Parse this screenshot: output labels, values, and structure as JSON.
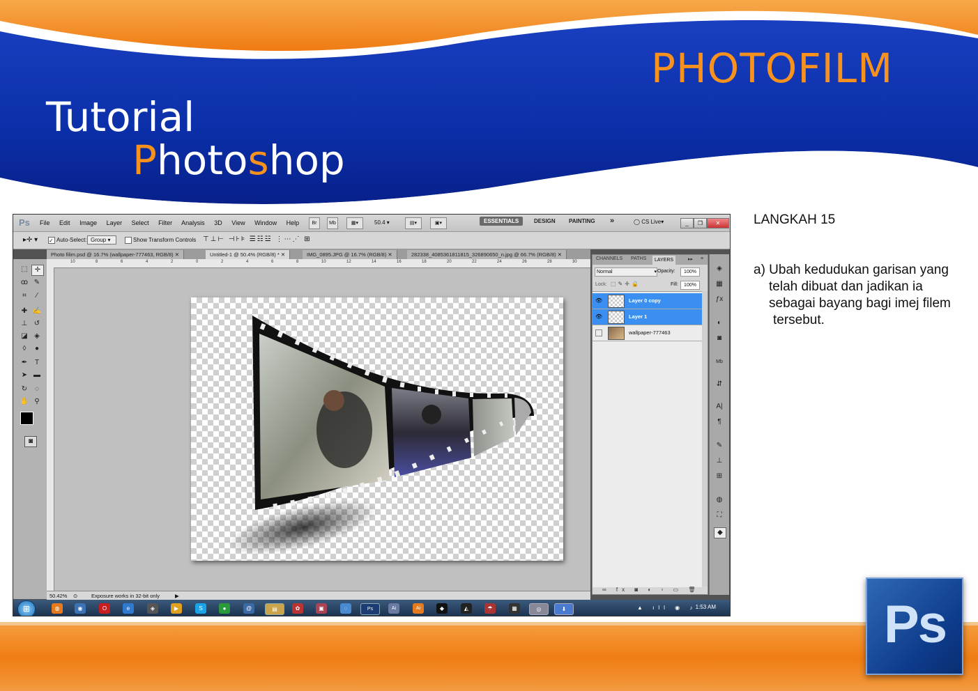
{
  "slide": {
    "title": "PHOTOFILM",
    "tutorial_line1": "Tutorial",
    "tutorial_line2_a": "P",
    "tutorial_line2_b": "hoto",
    "tutorial_line2_c": "s",
    "tutorial_line2_d": "hop",
    "step": "LANGKAH 15",
    "instruction_lines": [
      "a) Ubah kedudukan garisan yang",
      "telah dibuat dan jadikan ia",
      "sebagai bayang bagi imej filem",
      "tersebut."
    ],
    "logo_text": "Ps",
    "colors": {
      "orange": "#f7921e",
      "blue": "#0b2fa8"
    }
  },
  "ps": {
    "logo": "Ps",
    "menu": [
      "File",
      "Edit",
      "Image",
      "Layer",
      "Select",
      "Filter",
      "Analysis",
      "3D",
      "View",
      "Window",
      "Help"
    ],
    "zoom_field": "50.4",
    "workspaces": [
      "ESSENTIALS",
      "DESIGN",
      "PAINTING"
    ],
    "more_workspaces": "»",
    "cslive": "CS Live",
    "options": {
      "auto_select_label": "Auto-Select:",
      "auto_select_value": "Group",
      "show_transform": "Show Transform Controls"
    },
    "tabs": [
      "Photo filim.psd @ 16.7% (wallpaper-777463, RGB/8)",
      "Untitled-1 @ 50.4% (RGB/8) *",
      "IMG_0895.JPG @ 16.7% (RGB/8)",
      "282338_4085361811815_326890650_n.jpg @ 66.7% (RGB/8)"
    ],
    "ruler_h": [
      "10",
      "8",
      "6",
      "4",
      "2",
      "0",
      "2",
      "4",
      "6",
      "8",
      "10",
      "12",
      "14",
      "16",
      "18",
      "20",
      "22",
      "24",
      "26",
      "28",
      "30"
    ],
    "status": {
      "zoom": "50.42%",
      "message": "Exposure works in 32-bit only"
    },
    "panel": {
      "tabs": [
        "CHANNELS",
        "PATHS",
        "LAYERS"
      ],
      "blend": "Normal",
      "opacity_label": "Opacity:",
      "opacity_value": "100%",
      "lock_label": "Lock:",
      "fill_label": "Fill:",
      "fill_value": "100%",
      "layers": [
        {
          "name": "Layer 0 copy",
          "selected": true,
          "visible": true
        },
        {
          "name": "Layer 1",
          "selected": true,
          "visible": true
        },
        {
          "name": "wallpaper-777463",
          "selected": false,
          "visible": false
        }
      ]
    },
    "taskbar": {
      "clock": "1:53 AM"
    }
  }
}
